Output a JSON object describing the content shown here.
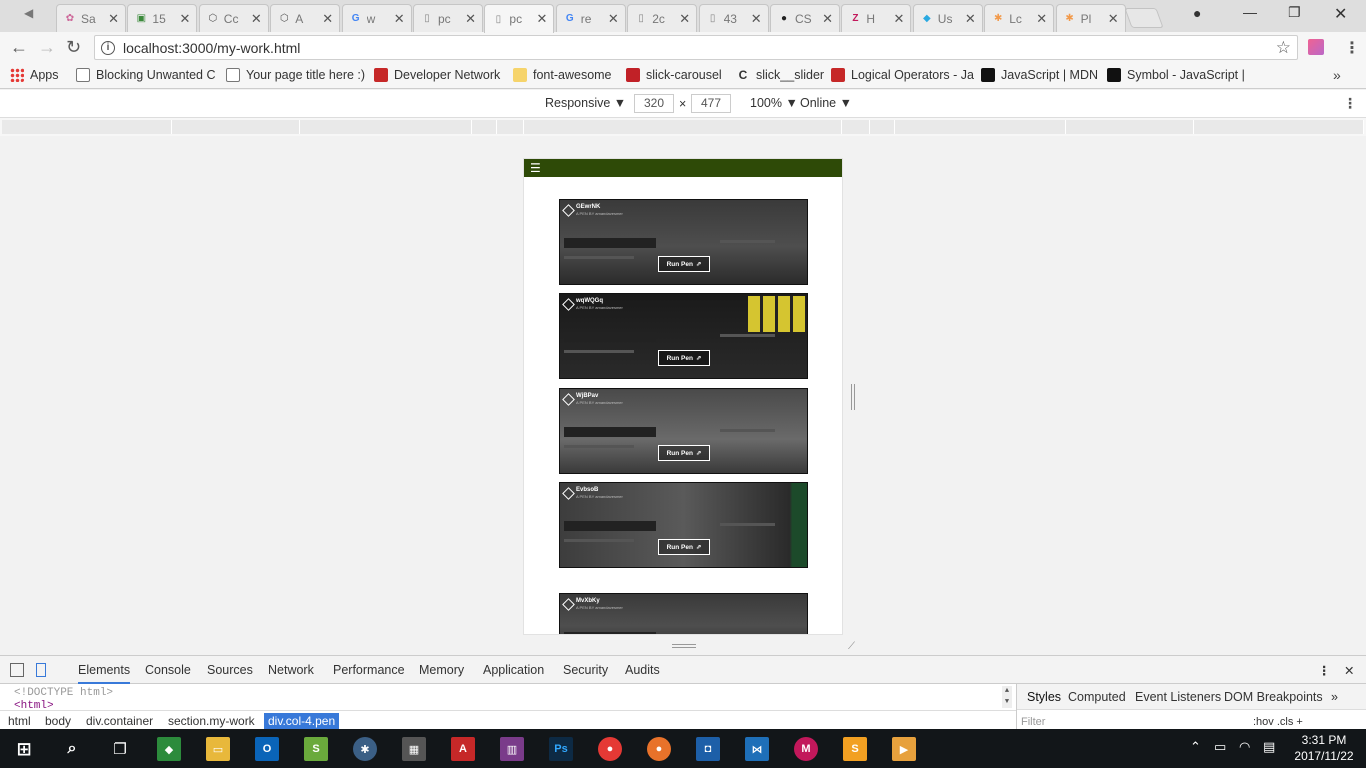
{
  "browser": {
    "tabs": [
      {
        "title": "Sa",
        "favicon": "sass-icon",
        "color": "#cd6799"
      },
      {
        "title": "15",
        "favicon": "android-icon",
        "color": "#3b8a3b"
      },
      {
        "title": "Cc",
        "favicon": "codepen-icon",
        "color": "#555555"
      },
      {
        "title": "A",
        "favicon": "codepen-icon",
        "color": "#555555"
      },
      {
        "title": "w",
        "favicon": "google-icon",
        "color": "#4285f4"
      },
      {
        "title": "pc",
        "favicon": "page-icon",
        "color": "#888888"
      },
      {
        "title": "pc",
        "favicon": "page-icon",
        "color": "#888888"
      },
      {
        "title": "re",
        "favicon": "google-icon",
        "color": "#4285f4"
      },
      {
        "title": "2c",
        "favicon": "page-icon",
        "color": "#888888"
      },
      {
        "title": "43",
        "favicon": "page-icon",
        "color": "#888888"
      },
      {
        "title": "CS",
        "favicon": "github-icon",
        "color": "#222222"
      },
      {
        "title": "H",
        "favicon": "zeplin-icon",
        "color": "#c2185b"
      },
      {
        "title": "Us",
        "favicon": "sitepoint-icon",
        "color": "#29a9e1"
      },
      {
        "title": "Lc",
        "favicon": "asterisk-icon",
        "color": "#f29a4b"
      },
      {
        "title": "Pl",
        "favicon": "asterisk-icon",
        "color": "#f29a4b"
      }
    ],
    "active_tab_index": 6,
    "url": "localhost:3000/my-work.html"
  },
  "bookmarks": [
    {
      "label": "Apps",
      "icon": "apps-grid-icon"
    },
    {
      "label": "Blocking Unwanted C",
      "icon": "page-icon"
    },
    {
      "label": "Your page title here :)",
      "icon": "page-icon"
    },
    {
      "label": "Developer Network",
      "icon": "mdn-icon"
    },
    {
      "label": "font-awesome",
      "icon": "folder-icon"
    },
    {
      "label": "slick-carousel",
      "icon": "npm-icon"
    },
    {
      "label": "slick__slider",
      "icon": "c-icon"
    },
    {
      "label": "Logical Operators - Ja",
      "icon": "mdn-icon"
    },
    {
      "label": "JavaScript | MDN",
      "icon": "mdn-dino-icon"
    },
    {
      "label": "Symbol - JavaScript |",
      "icon": "mdn-dino-icon"
    }
  ],
  "device_toolbar": {
    "device": "Responsive",
    "width": "320",
    "times": "×",
    "height": "477",
    "zoom": "100%",
    "throttle": "Online"
  },
  "site": {
    "menu_icon": "hamburger-icon",
    "pens": [
      {
        "name": "GEwrNK",
        "by": "A PEN BY amandavesmer",
        "run_label": "Run Pen"
      },
      {
        "name": "wqWQGq",
        "by": "A PEN BY amandavesmer",
        "run_label": "Run Pen"
      },
      {
        "name": "WjBPav",
        "by": "A PEN BY amandavesmer",
        "run_label": "Run Pen"
      },
      {
        "name": "EvbsoB",
        "by": "A PEN BY amandavesmer",
        "run_label": "Run Pen"
      },
      {
        "name": "MvXbKy",
        "by": "A PEN BY amandavesmer",
        "run_label": ""
      }
    ]
  },
  "devtools": {
    "tabs": [
      "Elements",
      "Console",
      "Sources",
      "Network",
      "Performance",
      "Memory",
      "Application",
      "Security",
      "Audits"
    ],
    "active_tab": "Elements",
    "dom_lines": [
      "<!DOCTYPE html>",
      "<html>"
    ],
    "breadcrumbs": [
      "html",
      "body",
      "div.container",
      "section.my-work",
      "div.col-4.pen"
    ],
    "selected_breadcrumb": "div.col-4.pen",
    "side_tabs": [
      "Styles",
      "Computed",
      "Event Listeners",
      "DOM Breakpoints"
    ],
    "filter_placeholder": "Filter",
    "filter_extras": ":hov  .cls  +"
  },
  "taskbar": {
    "time": "3:31 PM",
    "date": "2017/11/22"
  },
  "colors": {
    "site_nav": "#2e4a07",
    "selected_breadcrumb": "#3879d9",
    "taskbar": "#121619"
  }
}
